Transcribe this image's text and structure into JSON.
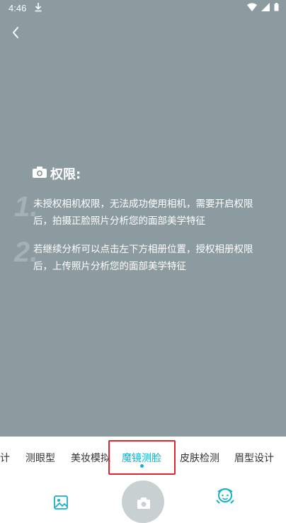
{
  "status_bar": {
    "time": "4:46"
  },
  "permission": {
    "title": "权限:",
    "items": [
      {
        "num": "1.",
        "text": "未授权相机权限，无法成功使用相机，需要开启权限后，拍摄正脸照片分析您的面部美学特征"
      },
      {
        "num": "2.",
        "text": "若继续分析可以点击左下方相册位置，授权相册权限后，上传照片分析您的面部美学特征"
      }
    ]
  },
  "tabs": [
    {
      "label": "计"
    },
    {
      "label": "测眼型"
    },
    {
      "label": "美妆模拟"
    },
    {
      "label": "魔镜测脸",
      "active": true
    },
    {
      "label": "皮肤检测"
    },
    {
      "label": "眉型设计"
    }
  ],
  "colors": {
    "camera_bg": "#8c9ba0",
    "accent": "#1ab0c8",
    "highlight_border": "#e0262e"
  },
  "icons": {
    "back": "chevron-left-icon",
    "camera": "camera-icon",
    "album": "image-icon",
    "shutter": "camera-icon",
    "beauty": "face-icon"
  }
}
